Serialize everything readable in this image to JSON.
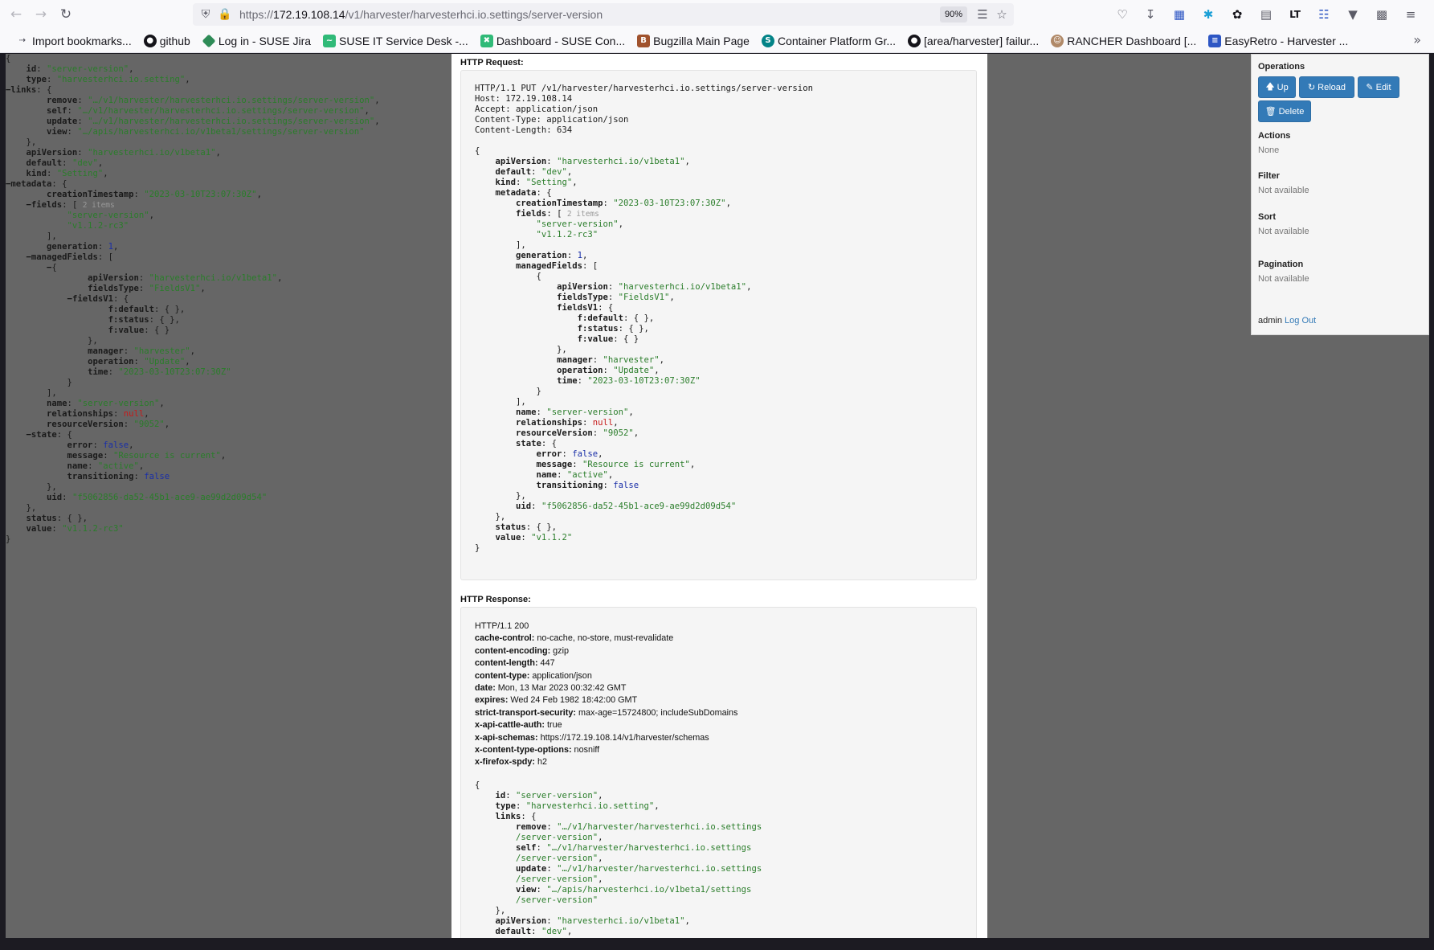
{
  "browser": {
    "url_prefix": "https://",
    "url_host": "172.19.108.14",
    "url_path": "/v1/harvester/harvesterhci.io.settings/server-version",
    "zoom": "90%",
    "bookmarks": [
      {
        "label": "Import bookmarks...",
        "icon": "import-icon",
        "color": "#5b5b66"
      },
      {
        "label": "github",
        "icon": "github-icon",
        "color": "#15141a"
      },
      {
        "label": "Log in - SUSE Jira",
        "icon": "jira-icon",
        "color": "#2e8b57"
      },
      {
        "label": "SUSE IT Service Desk -...",
        "icon": "suse-chameleon-icon",
        "color": "#30ba78"
      },
      {
        "label": "Dashboard - SUSE Con...",
        "icon": "dashboard-icon",
        "color": "#30ba78"
      },
      {
        "label": "Bugzilla Main Page",
        "icon": "bugzilla-icon",
        "color": "#a0522d"
      },
      {
        "label": "Container Platform Gr...",
        "icon": "sharepoint-icon",
        "color": "#038387"
      },
      {
        "label": "[area/harvester] failur...",
        "icon": "github-icon",
        "color": "#15141a"
      },
      {
        "label": "RANCHER Dashboard [...",
        "icon": "person-icon",
        "color": "#b08968"
      },
      {
        "label": "EasyRetro - Harvester ...",
        "icon": "easyretro-icon",
        "color": "#2d56c4"
      }
    ]
  },
  "left_json": {
    "id": "\"server-version\"",
    "type": "\"harvesterhci.io.setting\"",
    "links_remove": "\"…/v1/harvester/harvesterhci.io.settings/server-version\"",
    "links_self": "\"…/v1/harvester/harvesterhci.io.settings/server-version\"",
    "links_update": "\"…/v1/harvester/harvesterhci.io.settings/server-version\"",
    "links_view": "\"…/apis/harvesterhci.io/v1beta1/settings/server-version\"",
    "apiVersion": "\"harvesterhci.io/v1beta1\"",
    "default": "\"dev\"",
    "kind": "\"Setting\"",
    "creationTimestamp": "\"2023-03-10T23:07:30Z\"",
    "fields_count": "2 items",
    "fields_0": "\"server-version\"",
    "fields_1": "\"v1.1.2-rc3\"",
    "generation": "1",
    "mf_apiVersion": "\"harvesterhci.io/v1beta1\"",
    "mf_fieldsType": "\"FieldsV1\"",
    "mf_manager": "\"harvester\"",
    "mf_operation": "\"Update\"",
    "mf_time": "\"2023-03-10T23:07:30Z\"",
    "name": "\"server-version\"",
    "relationships": "null",
    "resourceVersion": "\"9052\"",
    "state_error": "false",
    "state_message": "\"Resource is current\"",
    "state_name": "\"active\"",
    "state_transitioning": "false",
    "uid": "\"f5062856-da52-45b1-ace9-ae99d2d09d54\"",
    "value": "\"v1.1.2-rc3\""
  },
  "request": {
    "title": "HTTP Request:",
    "line1": "HTTP/1.1 PUT /v1/harvester/harvesterhci.io.settings/server-version",
    "line2": "Host: 172.19.108.14",
    "line3": "Accept: application/json",
    "line4": "Content-Type: application/json",
    "line5": "Content-Length: 634",
    "apiVersion": "\"harvesterhci.io/v1beta1\"",
    "default": "\"dev\"",
    "kind": "\"Setting\"",
    "creationTimestamp": "\"2023-03-10T23:07:30Z\"",
    "fields_count": "2 items",
    "fields_0": "\"server-version\"",
    "fields_1": "\"v1.1.2-rc3\"",
    "generation": "1",
    "mf_apiVersion": "\"harvesterhci.io/v1beta1\"",
    "mf_fieldsType": "\"FieldsV1\"",
    "mf_manager": "\"harvester\"",
    "mf_operation": "\"Update\"",
    "mf_time": "\"2023-03-10T23:07:30Z\"",
    "name": "\"server-version\"",
    "relationships": "null",
    "resourceVersion": "\"9052\"",
    "state_error": "false",
    "state_message": "\"Resource is current\"",
    "state_name": "\"active\"",
    "state_transitioning": "false",
    "uid": "\"f5062856-da52-45b1-ace9-ae99d2d09d54\"",
    "value": "\"v1.1.2\""
  },
  "response": {
    "title": "HTTP Response:",
    "status": "HTTP/1.1 200",
    "headers": [
      {
        "k": "cache-control:",
        "v": " no-cache, no-store, must-revalidate"
      },
      {
        "k": "content-encoding:",
        "v": " gzip"
      },
      {
        "k": "content-length:",
        "v": " 447"
      },
      {
        "k": "content-type:",
        "v": " application/json"
      },
      {
        "k": "date:",
        "v": " Mon, 13 Mar 2023 00:32:42 GMT"
      },
      {
        "k": "expires:",
        "v": " Wed 24 Feb 1982 18:42:00 GMT"
      },
      {
        "k": "strict-transport-security:",
        "v": " max-age=15724800; includeSubDomains"
      },
      {
        "k": "x-api-cattle-auth:",
        "v": " true"
      },
      {
        "k": "x-api-schemas:",
        "v": " https://172.19.108.14/v1/harvester/schemas"
      },
      {
        "k": "x-content-type-options:",
        "v": " nosniff"
      },
      {
        "k": "x-firefox-spdy:",
        "v": " h2"
      }
    ],
    "id": "\"server-version\"",
    "type": "\"harvesterhci.io.setting\"",
    "remove_a": "\"…/v1/harvester/harvesterhci.io.settings",
    "remove_b": "/server-version\"",
    "self_a": "\"…/v1/harvester/harvesterhci.io.settings",
    "self_b": "/server-version\"",
    "update_a": "\"…/v1/harvester/harvesterhci.io.settings",
    "update_b": "/server-version\"",
    "view_a": "\"…/apis/harvesterhci.io/v1beta1/settings",
    "view_b": "/server-version\"",
    "apiVersion": "\"harvesterhci.io/v1beta1\"",
    "default": "\"dev\""
  },
  "operations": {
    "title": "Operations",
    "up": "Up",
    "reload": "Reload",
    "edit": "Edit",
    "delete": "Delete",
    "actions_title": "Actions",
    "actions_value": "None",
    "filter_title": "Filter",
    "filter_value": "Not available",
    "sort_title": "Sort",
    "sort_value": "Not available",
    "pagination_title": "Pagination",
    "pagination_value": "Not available",
    "user": "admin",
    "logout": "Log Out"
  }
}
